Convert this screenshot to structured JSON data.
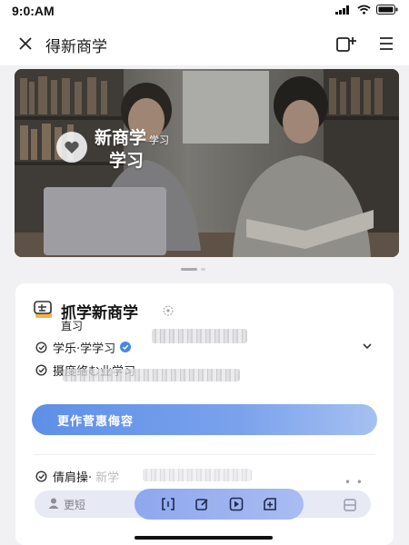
{
  "status": {
    "time": "9:0:AM"
  },
  "header": {
    "title": "得新商学",
    "close_icon": "close-icon",
    "add_icon": "add-window-icon",
    "menu_icon": "menu-icon"
  },
  "banner": {
    "title": "新商学",
    "title_small": "学习",
    "subtitle": "学习"
  },
  "card": {
    "title": "抓学新商学",
    "subtitle": "直习",
    "rows": [
      {
        "label": "学乐·学学习"
      },
      {
        "label": "摄度络む业学习"
      }
    ],
    "cta_label": "更作菅惠侮容",
    "bottom_row_label": "倩肩操·",
    "bottom_row_blur": "新学"
  },
  "input": {
    "placeholder": "更短"
  },
  "colors": {
    "accent": "#5e8fe8",
    "toolbar": "#9db2f1"
  }
}
